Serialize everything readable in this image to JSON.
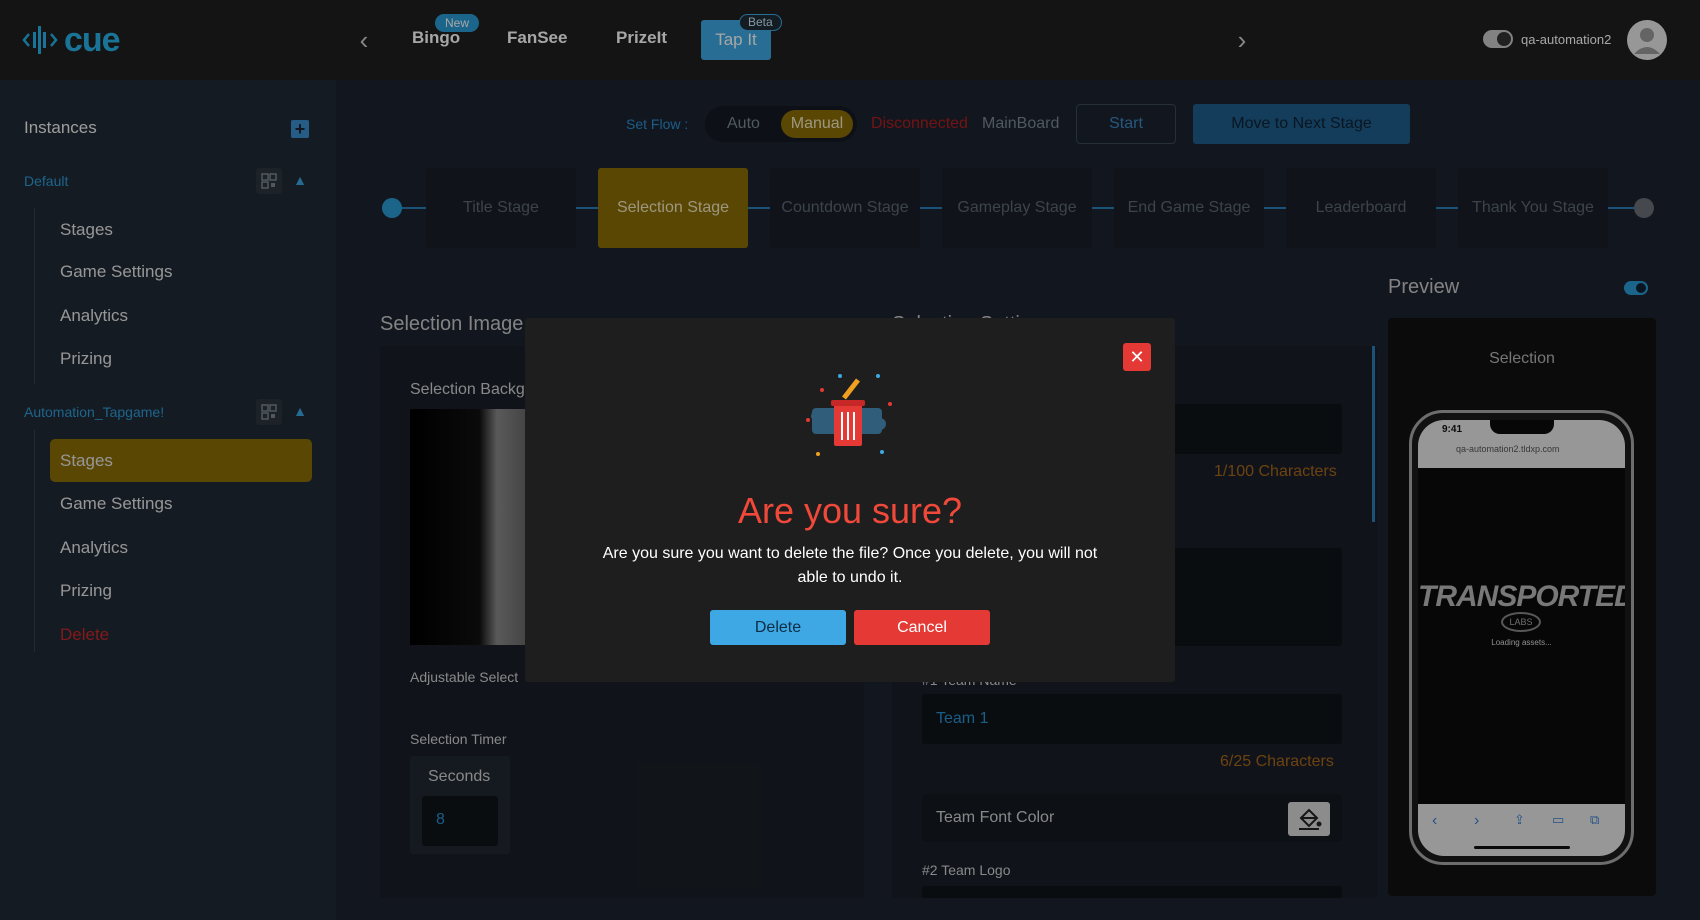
{
  "brand": {
    "logo_text": "cue"
  },
  "topnav": {
    "tabs": [
      {
        "label": "Bingo",
        "badge": "New"
      },
      {
        "label": "FanSee"
      },
      {
        "label": "PrizeIt"
      },
      {
        "label": "Tap It",
        "badge": "Beta",
        "active": true
      }
    ],
    "username": "qa-automation2"
  },
  "sidebar": {
    "title": "Instances",
    "groups": [
      {
        "name": "Default",
        "items": [
          "Stages",
          "Game Settings",
          "Analytics",
          "Prizing"
        ]
      },
      {
        "name": "Automation_Tapgame!",
        "items": [
          "Stages",
          "Game Settings",
          "Analytics",
          "Prizing",
          "Delete"
        ]
      }
    ]
  },
  "flow": {
    "set_flow_label": "Set Flow :",
    "auto": "Auto",
    "manual": "Manual",
    "status": "Disconnected",
    "board": "MainBoard",
    "start": "Start",
    "next": "Move to Next Stage"
  },
  "stages": [
    "Title Stage",
    "Selection Stage",
    "Countdown Stage",
    "Gameplay Stage",
    "End Game Stage",
    "Leaderboard",
    "Thank You Stage"
  ],
  "left_panel": {
    "title": "Selection Image",
    "bg_label": "Selection Backg",
    "adjustable_label": "Adjustable Select",
    "timer_label": "Selection Timer",
    "seconds_label": "Seconds",
    "seconds_value": "8"
  },
  "right_panel": {
    "title_partial": "Selection Setti",
    "counter1": "1/100 Characters",
    "team_name_label": "#1 Team Name",
    "team_name_value": "Team 1",
    "counter2": "6/25 Characters",
    "team_font_color": "Team Font Color",
    "team_logo_label": "#2 Team Logo"
  },
  "preview": {
    "title": "Preview",
    "screen_label": "Selection",
    "phone_time": "9:41",
    "url": "qa-automation2.tldxp.com",
    "logo_main": "TRANSPORTED",
    "logo_sub": "LABS",
    "loading": "Loading assets..."
  },
  "modal": {
    "title": "Are you sure?",
    "message": "Are you sure you want to delete the file? Once you delete, you will not able to undo it.",
    "delete": "Delete",
    "cancel": "Cancel"
  },
  "colors": {
    "accent": "#3da8e3",
    "gold": "#8a6d06",
    "danger": "#e53935"
  }
}
